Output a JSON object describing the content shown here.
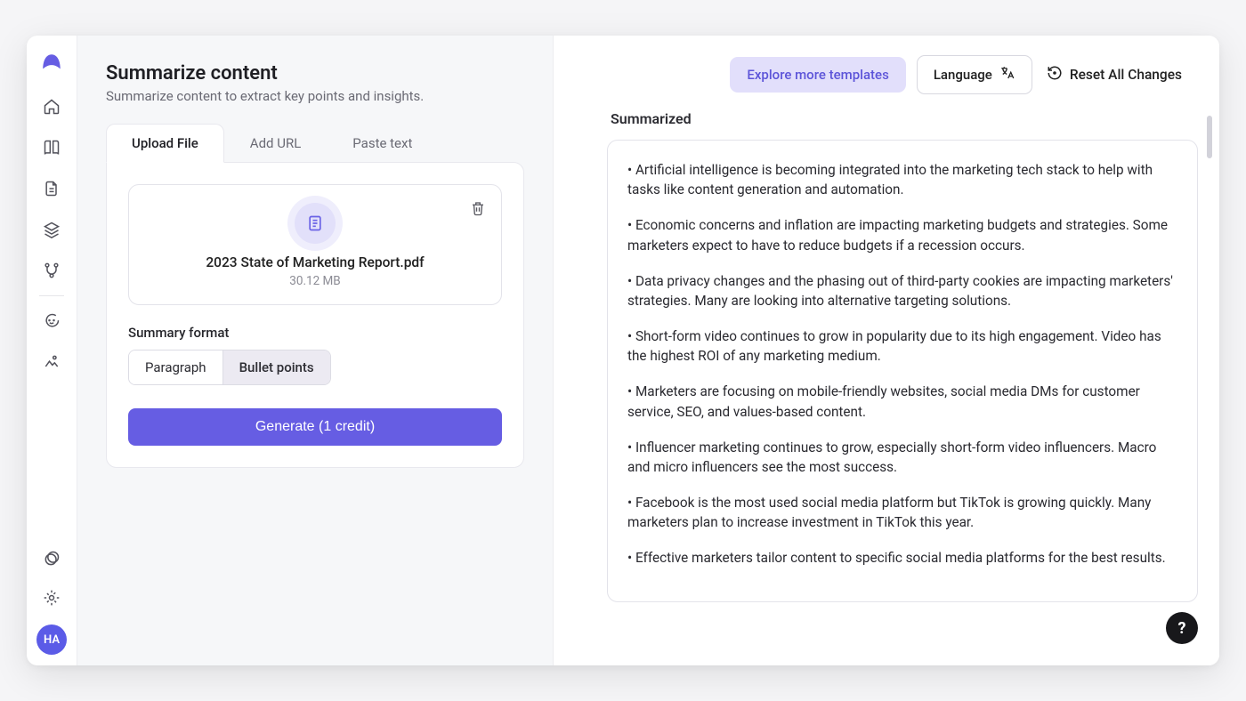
{
  "sidebar": {
    "avatar_initials": "HA"
  },
  "page": {
    "title": "Summarize content",
    "subtitle": "Summarize content to extract key points and insights."
  },
  "tabs": {
    "upload": "Upload File",
    "url": "Add URL",
    "paste": "Paste text"
  },
  "file": {
    "name": "2023 State of Marketing Report.pdf",
    "size": "30.12 MB"
  },
  "format": {
    "label": "Summary format",
    "paragraph": "Paragraph",
    "bullets": "Bullet points"
  },
  "generate_label": "Generate (1 credit)",
  "topbar": {
    "explore": "Explore more templates",
    "language": "Language",
    "reset": "Reset All Changes"
  },
  "output": {
    "heading": "Summarized",
    "bullets": [
      "• Artificial intelligence is becoming integrated into the marketing tech stack to help with tasks like content generation and automation.",
      "• Economic concerns and inflation are impacting marketing budgets and strategies. Some marketers expect to have to reduce budgets if a recession occurs.",
      "• Data privacy changes and the phasing out of third-party cookies are impacting marketers' strategies. Many are looking into alternative targeting solutions.",
      "• Short-form video continues to grow in popularity due to its high engagement. Video has the highest ROI of any marketing medium.",
      "• Marketers are focusing on mobile-friendly websites, social media DMs for customer service, SEO, and values-based content.",
      "• Influencer marketing continues to grow, especially short-form video influencers. Macro and micro influencers see the most success.",
      "• Facebook is the most used social media platform but TikTok is growing quickly. Many marketers plan to increase investment in TikTok this year.",
      "• Effective marketers tailor content to specific social media platforms for the best results."
    ]
  },
  "help_glyph": "?"
}
